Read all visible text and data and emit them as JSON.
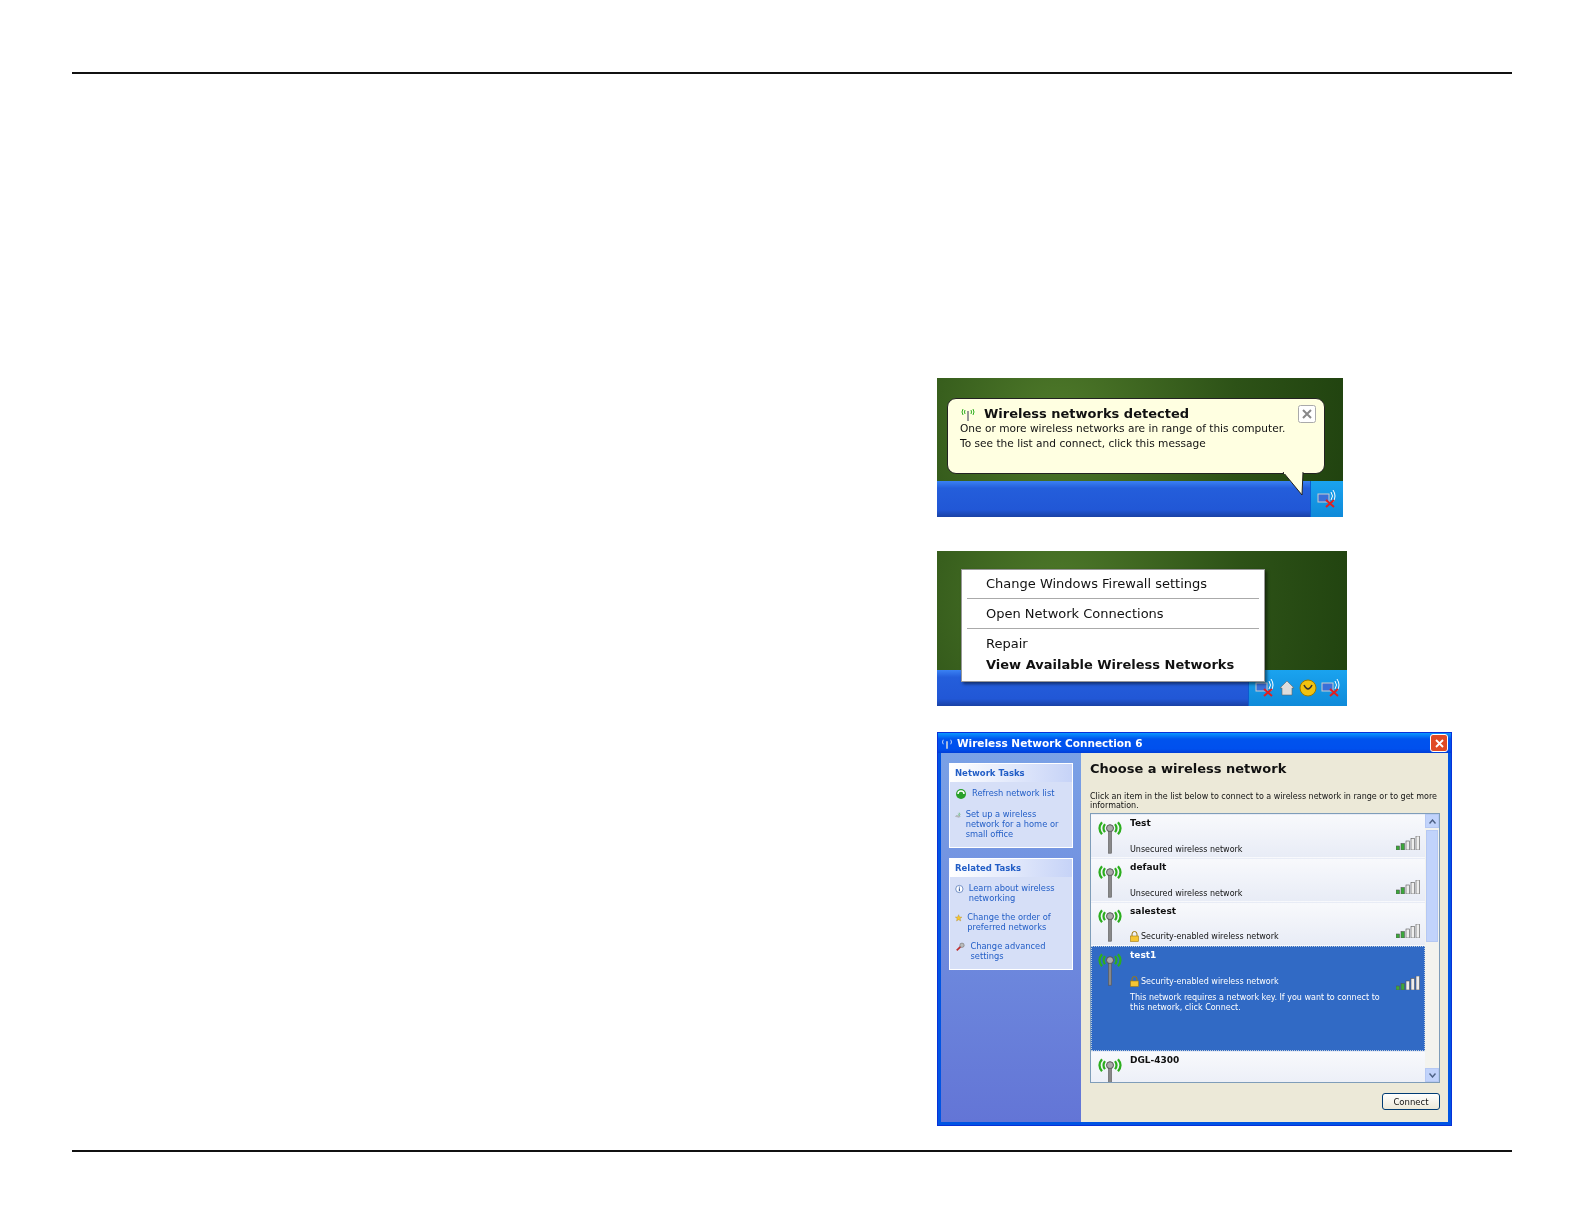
{
  "balloon_shot": {
    "title": "Wireless networks detected",
    "message_lines": [
      "One or more wireless networks are in range of this computer.",
      "To see the list and connect, click this message"
    ]
  },
  "menu_shot": {
    "groups": [
      [
        {
          "label": "Change Windows Firewall settings",
          "default": false
        }
      ],
      [
        {
          "label": "Open Network Connections",
          "default": false
        }
      ],
      [
        {
          "label": "Repair",
          "default": false
        },
        {
          "label": "View Available Wireless Networks",
          "default": true
        }
      ]
    ]
  },
  "dialog": {
    "title": "Wireless Network Connection 6",
    "sidebar": [
      {
        "title": "Network Tasks",
        "items": [
          "Refresh network list",
          "Set up a wireless network for a home or small office"
        ]
      },
      {
        "title": "Related Tasks",
        "items": [
          "Learn about wireless networking",
          "Change the order of preferred networks",
          "Change advanced settings"
        ]
      }
    ],
    "heading": "Choose a wireless network",
    "instructions": "Click an item in the list below to connect to a wireless network in range or to get more information.",
    "networks": [
      {
        "name": "Test",
        "security": "Unsecured wireless network",
        "kind": "open",
        "selected": false
      },
      {
        "name": "default",
        "security": "Unsecured wireless network",
        "kind": "open",
        "selected": false
      },
      {
        "name": "salestest",
        "security": "Security-enabled wireless network",
        "kind": "secured",
        "selected": false
      },
      {
        "name": "test1",
        "security": "Security-enabled wireless network",
        "kind": "secured",
        "selected": true,
        "details": "This network requires a network key. If you want to connect to this network, click Connect."
      },
      {
        "name": "DGL-4300",
        "selected": false
      }
    ],
    "connect_button": "Connect"
  }
}
